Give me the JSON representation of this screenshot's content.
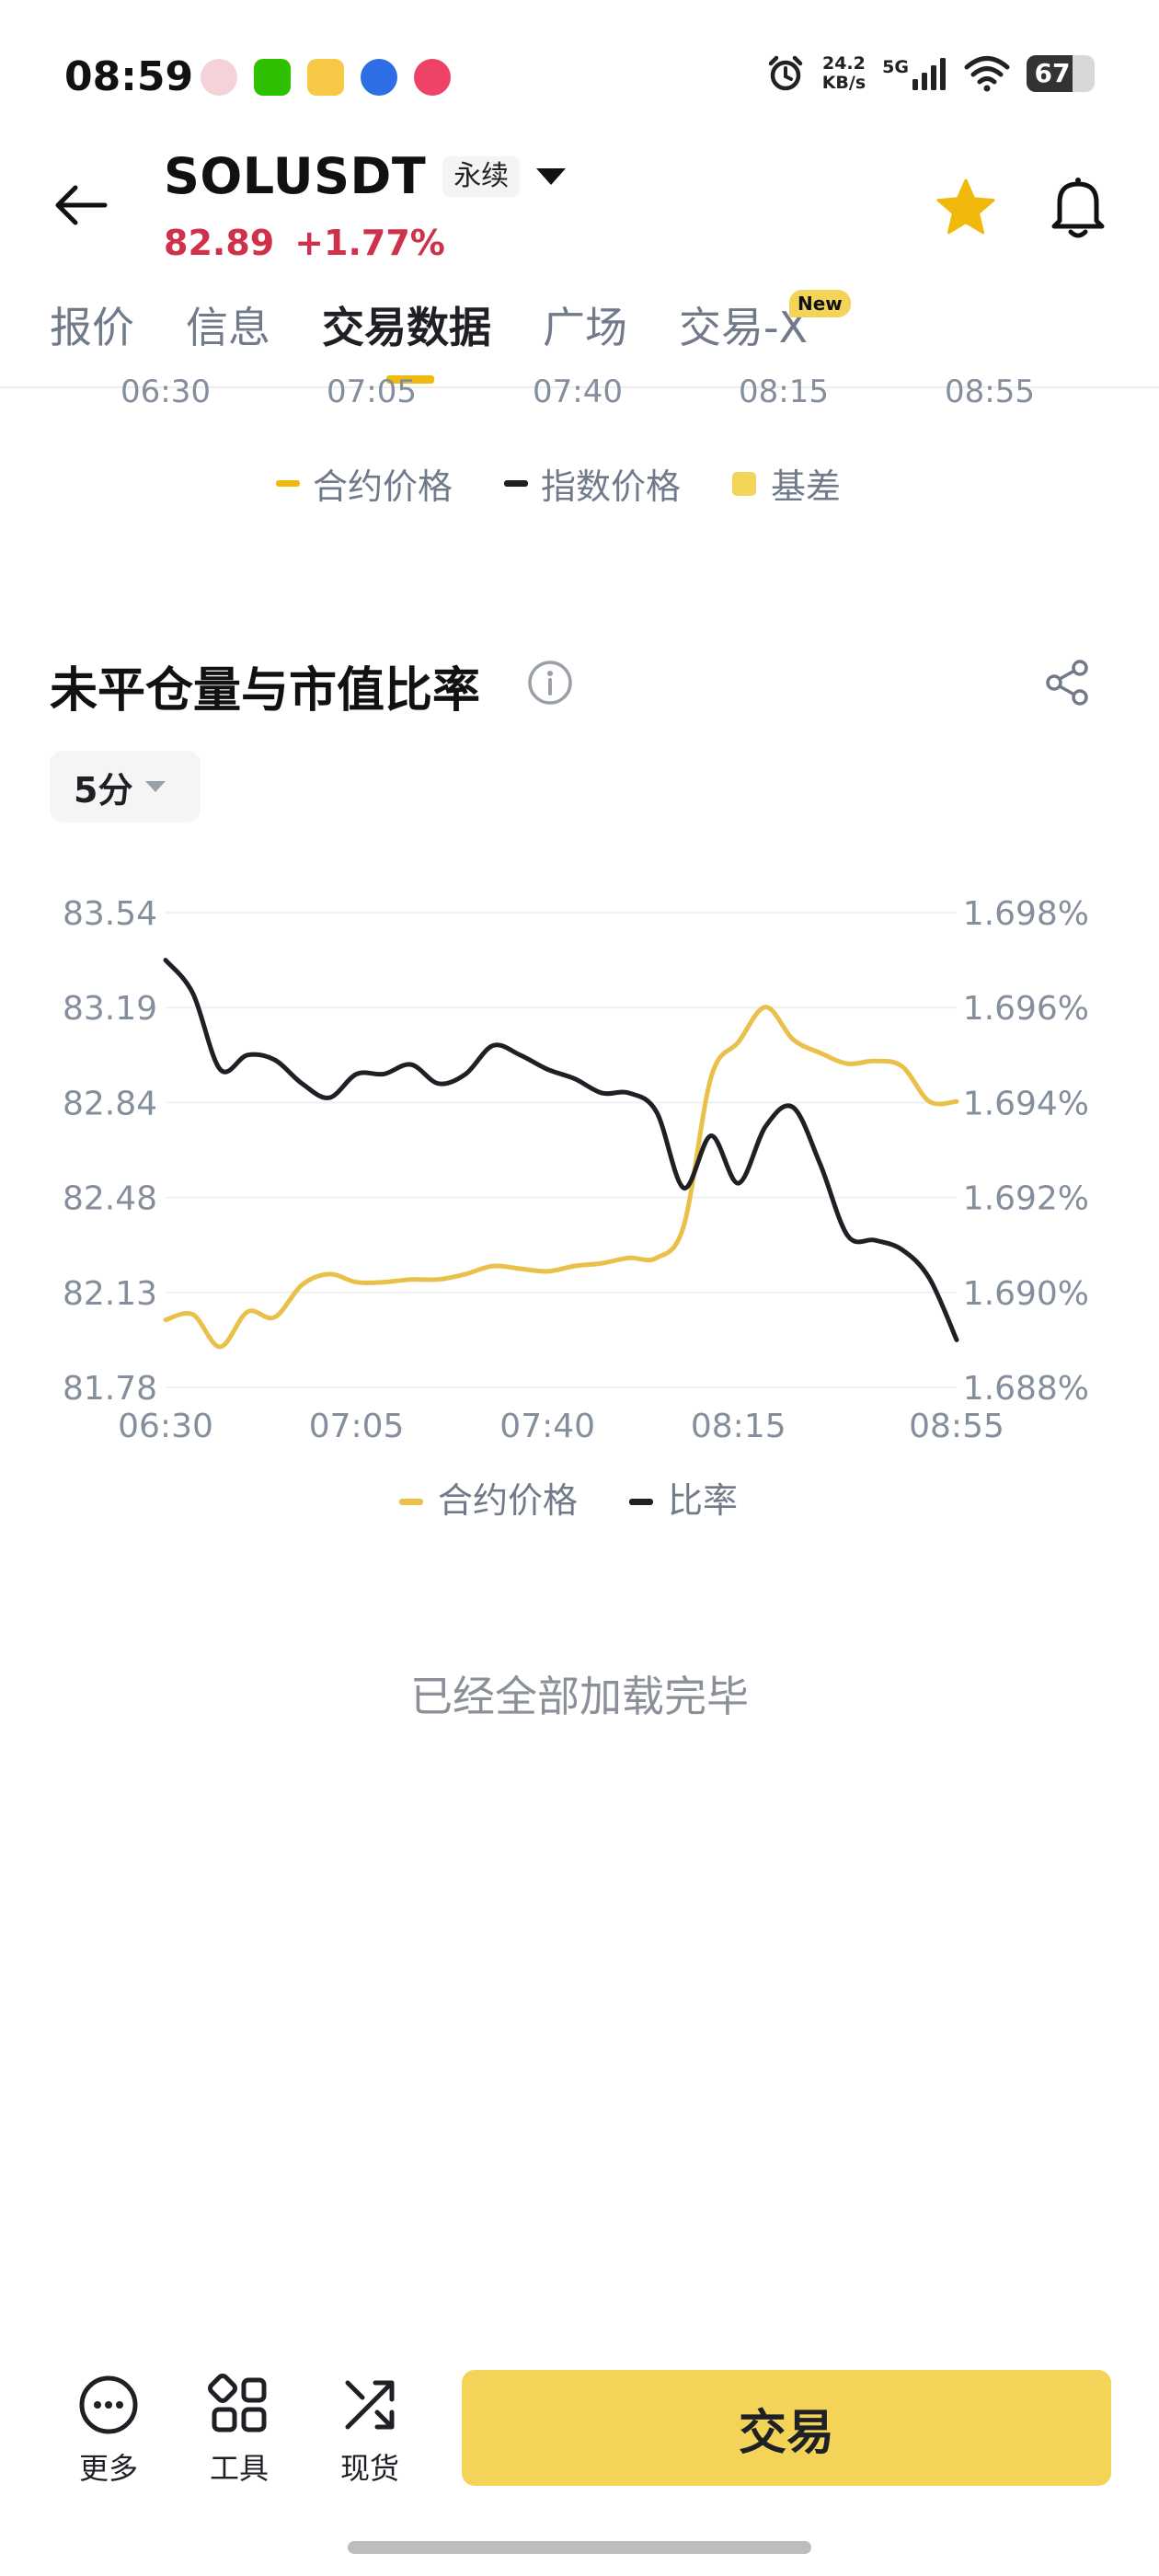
{
  "status_bar": {
    "time": "08:59",
    "net_speed_value": "24.2",
    "net_speed_unit": "KB/s",
    "network": "5G",
    "battery": "67",
    "battery_level": 0.67
  },
  "header": {
    "symbol": "SOLUSDT",
    "contract_type": "永续",
    "last_price": "82.89",
    "change_pct": "+1.77%",
    "change_color": "#cf304a"
  },
  "tabs": [
    "报价",
    "信息",
    "交易数据",
    "广场",
    "交易-X"
  ],
  "tabs_active_index": 2,
  "new_badge": "New",
  "prev_chart": {
    "x_ticks": [
      "06:30",
      "07:05",
      "07:40",
      "08:15",
      "08:55"
    ],
    "legend": [
      {
        "label": "合约价格",
        "color": "#f0b90b",
        "shape": "dash"
      },
      {
        "label": "指数价格",
        "color": "#1e2026",
        "shape": "dash"
      },
      {
        "label": "基差",
        "color": "#f3d458",
        "shape": "box"
      }
    ]
  },
  "section": {
    "title": "未平仓量与市值比率",
    "interval": "5分"
  },
  "chart_data": {
    "type": "line",
    "x": [
      "06:30",
      "06:35",
      "06:40",
      "06:45",
      "06:50",
      "06:55",
      "07:00",
      "07:05",
      "07:10",
      "07:15",
      "07:20",
      "07:25",
      "07:30",
      "07:35",
      "07:40",
      "07:45",
      "07:50",
      "07:55",
      "08:00",
      "08:05",
      "08:10",
      "08:15",
      "08:20",
      "08:25",
      "08:30",
      "08:35",
      "08:40",
      "08:45",
      "08:50",
      "08:55"
    ],
    "x_ticks": [
      "06:30",
      "07:05",
      "07:40",
      "08:15",
      "08:55"
    ],
    "left_ticks": [
      "83.54",
      "83.19",
      "82.84",
      "82.48",
      "82.13",
      "81.78"
    ],
    "right_ticks": [
      "1.698%",
      "1.696%",
      "1.694%",
      "1.692%",
      "1.690%",
      "1.688%"
    ],
    "ylim_left": [
      81.78,
      83.54
    ],
    "ylim_right": [
      1.688,
      1.698
    ],
    "grid": true,
    "legend_position": "bottom-center",
    "series": [
      {
        "name": "合约价格",
        "axis": "left",
        "color": "#e9c04a",
        "values": [
          82.03,
          82.05,
          81.93,
          82.06,
          82.04,
          82.16,
          82.2,
          82.17,
          82.17,
          82.18,
          82.18,
          82.2,
          82.23,
          82.22,
          82.21,
          82.23,
          82.24,
          82.26,
          82.26,
          82.38,
          82.93,
          83.06,
          83.19,
          83.07,
          83.02,
          82.98,
          82.99,
          82.97,
          82.84,
          82.84
        ],
        "unit": ""
      },
      {
        "name": "比率",
        "axis": "right",
        "color": "#1e2026",
        "values": [
          1.697,
          1.6963,
          1.6947,
          1.695,
          1.6949,
          1.6944,
          1.6941,
          1.6946,
          1.6946,
          1.6948,
          1.6944,
          1.6946,
          1.6952,
          1.695,
          1.6947,
          1.6945,
          1.6942,
          1.6942,
          1.6938,
          1.6922,
          1.6933,
          1.6923,
          1.6935,
          1.6939,
          1.6927,
          1.6912,
          1.6911,
          1.6909,
          1.6903,
          1.689
        ],
        "unit": "%"
      }
    ]
  },
  "footer_text": "已经全部加载完毕",
  "bottom_nav": [
    {
      "label": "更多",
      "icon": "more-icon"
    },
    {
      "label": "工具",
      "icon": "tools-icon"
    },
    {
      "label": "现货",
      "icon": "spot-icon"
    }
  ],
  "trade_button": "交易"
}
